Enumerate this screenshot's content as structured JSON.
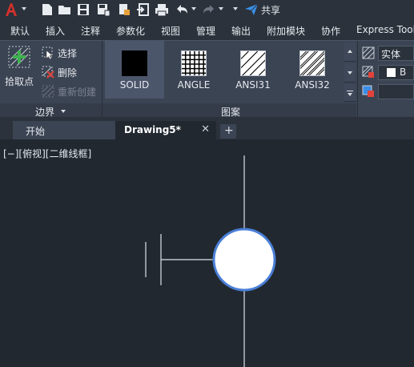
{
  "quick_access": {
    "share_label": "共享"
  },
  "ribbon": {
    "tabs": [
      "默认",
      "插入",
      "注释",
      "参数化",
      "视图",
      "管理",
      "输出",
      "附加模块",
      "协作",
      "Express Tools"
    ]
  },
  "boundary_panel": {
    "pick_points_label": "拾取点",
    "select_label": "选择",
    "remove_label": "删除",
    "recreate_label": "重新创建",
    "title": "边界"
  },
  "pattern_panel": {
    "title": "图案",
    "patterns": [
      {
        "name": "SOLID"
      },
      {
        "name": "ANGLE"
      },
      {
        "name": "ANSI31"
      },
      {
        "name": "ANSI32"
      }
    ]
  },
  "properties_panel": {
    "pattern_type": "实体",
    "color_value": "B"
  },
  "document_tabs": [
    {
      "label": "开始",
      "active": false
    },
    {
      "label": "Drawing5*",
      "active": true
    }
  ],
  "viewport": {
    "label": "[−][俯视][二维线框]"
  },
  "colors": {
    "app_red": "#d9302b",
    "share_blue": "#3a8ee6",
    "add_green": "#3fb24f",
    "canvas_bg": "#212830",
    "circle_outline": "#4a7fd6"
  }
}
